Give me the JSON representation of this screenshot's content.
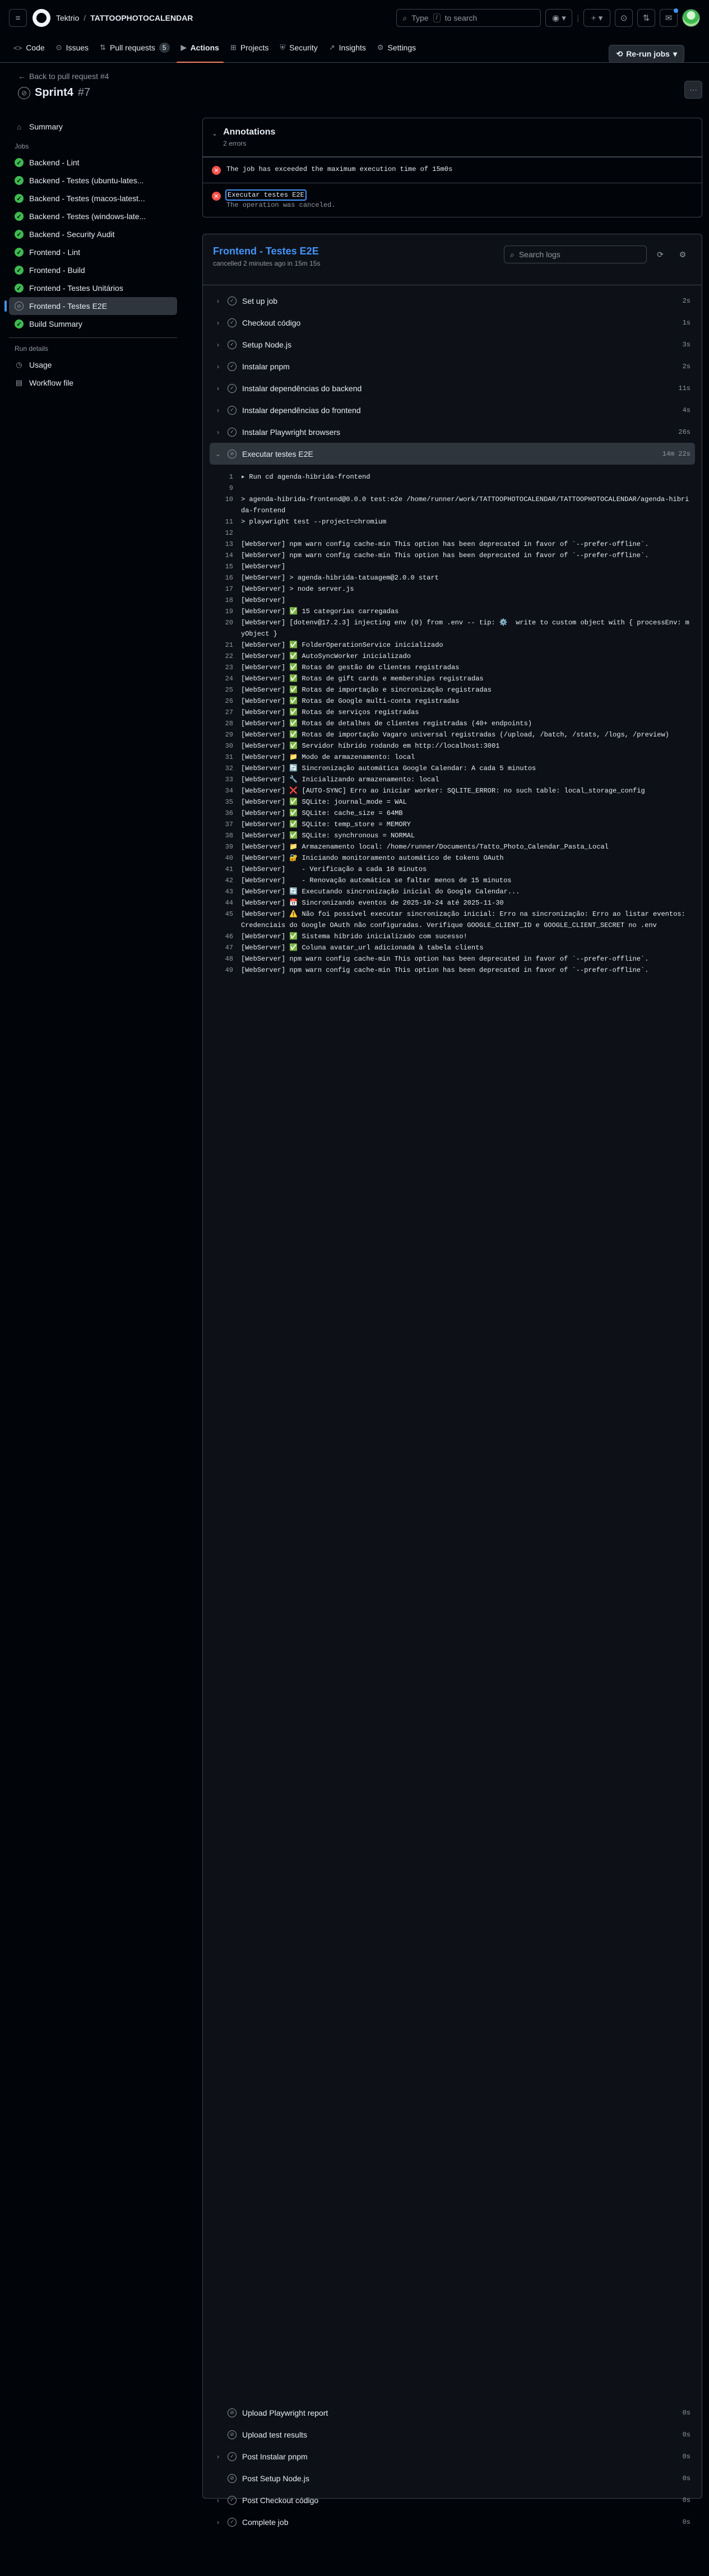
{
  "header": {
    "owner": "Tektrio",
    "separator": "/",
    "repo": "TATTOOPHOTOCALENDAR",
    "search_prefix": "Type",
    "search_key": "/",
    "search_suffix": "to search"
  },
  "nav": {
    "tabs": [
      {
        "icon": "<>",
        "label": "Code"
      },
      {
        "icon": "⊙",
        "label": "Issues"
      },
      {
        "icon": "⇅",
        "label": "Pull requests",
        "count": "5"
      },
      {
        "icon": "▶",
        "label": "Actions"
      },
      {
        "icon": "⊞",
        "label": "Projects"
      },
      {
        "icon": "⛨",
        "label": "Security"
      },
      {
        "icon": "↗",
        "label": "Insights"
      },
      {
        "icon": "⚙",
        "label": "Settings"
      }
    ]
  },
  "run": {
    "back_label": "Back to pull request #4",
    "title": "Sprint4",
    "number": "#7",
    "rerun_label": "Re-run jobs"
  },
  "sidebar": {
    "summary": "Summary",
    "jobs_label": "Jobs",
    "jobs": [
      "Backend - Lint",
      "Backend - Testes (ubuntu-lates...",
      "Backend - Testes (macos-latest...",
      "Backend - Testes (windows-late...",
      "Backend - Security Audit",
      "Frontend - Lint",
      "Frontend - Build",
      "Frontend - Testes Unitários",
      "Frontend - Testes E2E",
      "Build Summary"
    ],
    "run_details_label": "Run details",
    "usage": "Usage",
    "workflow_file": "Workflow file"
  },
  "annotations": {
    "title": "Annotations",
    "subtitle": "2 errors",
    "items": [
      {
        "title": "The job has exceeded the maximum execution time of 15m0s",
        "detail": ""
      },
      {
        "title": "Executar testes E2E",
        "detail": "The operation was canceled."
      }
    ]
  },
  "job": {
    "title": "Frontend - Testes E2E",
    "subtitle": "cancelled 2 minutes ago in 15m 15s",
    "search_placeholder": "Search logs",
    "steps": [
      {
        "label": "Set up job",
        "dur": "2s"
      },
      {
        "label": "Checkout código",
        "dur": "1s"
      },
      {
        "label": "Setup Node.js",
        "dur": "3s"
      },
      {
        "label": "Instalar pnpm",
        "dur": "2s"
      },
      {
        "label": "Instalar dependências do backend",
        "dur": "11s"
      },
      {
        "label": "Instalar dependências do frontend",
        "dur": "4s"
      },
      {
        "label": "Instalar Playwright browsers",
        "dur": "26s"
      }
    ],
    "open_step": {
      "label": "Executar testes E2E",
      "dur": "14m 22s"
    },
    "log": [
      {
        "n": "1",
        "t": "▸ Run cd agenda-hibrida-frontend"
      },
      {
        "n": "9",
        "t": ""
      },
      {
        "n": "10",
        "t": "> agenda-hibrida-frontend@0.0.0 test:e2e /home/runner/work/TATTOOPHOTOCALENDAR/TATTOOPHOTOCALENDAR/agenda-hibrida-frontend"
      },
      {
        "n": "11",
        "t": "> playwright test --project=chromium"
      },
      {
        "n": "12",
        "t": ""
      },
      {
        "n": "13",
        "t": "[WebServer] npm warn config cache-min This option has been deprecated in favor of `--prefer-offline`."
      },
      {
        "n": "14",
        "t": "[WebServer] npm warn config cache-min This option has been deprecated in favor of `--prefer-offline`."
      },
      {
        "n": "15",
        "t": "[WebServer]"
      },
      {
        "n": "16",
        "t": "[WebServer] > agenda-hibrida-tatuagem@2.0.0 start"
      },
      {
        "n": "17",
        "t": "[WebServer] > node server.js"
      },
      {
        "n": "18",
        "t": "[WebServer]"
      },
      {
        "n": "19",
        "t": "[WebServer] ✅ 15 categorias carregadas"
      },
      {
        "n": "20",
        "t": "[WebServer] [dotenv@17.2.3] injecting env (0) from .env -- tip: ⚙️  write to custom object with { processEnv: myObject }"
      },
      {
        "n": "21",
        "t": "[WebServer] ✅ FolderOperationService inicializado"
      },
      {
        "n": "22",
        "t": "[WebServer] ✅ AutoSyncWorker inicializado"
      },
      {
        "n": "23",
        "t": "[WebServer] ✅ Rotas de gestão de clientes registradas"
      },
      {
        "n": "24",
        "t": "[WebServer] ✅ Rotas de gift cards e memberships registradas"
      },
      {
        "n": "25",
        "t": "[WebServer] ✅ Rotas de importação e sincronização registradas"
      },
      {
        "n": "26",
        "t": "[WebServer] ✅ Rotas de Google multi-conta registradas"
      },
      {
        "n": "27",
        "t": "[WebServer] ✅ Rotas de serviços registradas"
      },
      {
        "n": "28",
        "t": "[WebServer] ✅ Rotas de detalhes de clientes registradas (40+ endpoints)"
      },
      {
        "n": "29",
        "t": "[WebServer] ✅ Rotas de importação Vagaro universal registradas (/upload, /batch, /stats, /logs, /preview)"
      },
      {
        "n": "30",
        "t": "[WebServer] ✅ Servidor híbrido rodando em http://localhost:3001"
      },
      {
        "n": "31",
        "t": "[WebServer] 📁 Modo de armazenamento: local"
      },
      {
        "n": "32",
        "t": "[WebServer] 🔄 Sincronização automática Google Calendar: A cada 5 minutos"
      },
      {
        "n": "33",
        "t": "[WebServer] 🔧 Inicializando armazenamento: local"
      },
      {
        "n": "34",
        "t": "[WebServer] ❌ [AUTO-SYNC] Erro ao iniciar worker: SQLITE_ERROR: no such table: local_storage_config"
      },
      {
        "n": "35",
        "t": "[WebServer] ✅ SQLite: journal_mode = WAL"
      },
      {
        "n": "36",
        "t": "[WebServer] ✅ SQLite: cache_size = 64MB"
      },
      {
        "n": "37",
        "t": "[WebServer] ✅ SQLite: temp_store = MEMORY"
      },
      {
        "n": "38",
        "t": "[WebServer] ✅ SQLite: synchronous = NORMAL"
      },
      {
        "n": "39",
        "t": "[WebServer] 📁 Armazenamento local: /home/runner/Documents/Tatto_Photo_Calendar_Pasta_Local"
      },
      {
        "n": "40",
        "t": "[WebServer] 🔐 Iniciando monitoramento automático de tokens OAuth"
      },
      {
        "n": "41",
        "t": "[WebServer]    - Verificação a cada 10 minutos"
      },
      {
        "n": "42",
        "t": "[WebServer]    - Renovação automática se faltar menos de 15 minutos"
      },
      {
        "n": "43",
        "t": "[WebServer] 🔄 Executando sincronização inicial do Google Calendar..."
      },
      {
        "n": "44",
        "t": "[WebServer] 📅 Sincronizando eventos de 2025-10-24 até 2025-11-30"
      },
      {
        "n": "45",
        "t": "[WebServer] ⚠️ Não foi possível executar sincronização inicial: Erro na sincronização: Erro ao listar eventos: Credenciais do Google OAuth não configuradas. Verifique GOOGLE_CLIENT_ID e GOOGLE_CLIENT_SECRET no .env"
      },
      {
        "n": "46",
        "t": "[WebServer] ✅ Sistema híbrido inicializado com sucesso!"
      },
      {
        "n": "47",
        "t": "[WebServer] ✅ Coluna avatar_url adicionada à tabela clients"
      },
      {
        "n": "48",
        "t": "[WebServer] npm warn config cache-min This option has been deprecated in favor of `--prefer-offline`."
      },
      {
        "n": "49",
        "t": "[WebServer] npm warn config cache-min This option has been deprecated in favor of `--prefer-offline`."
      }
    ],
    "bottom_steps": [
      {
        "label": "Upload Playwright report",
        "dur": "0s",
        "expand": false
      },
      {
        "label": "Upload test results",
        "dur": "0s",
        "expand": false
      },
      {
        "label": "Post Instalar pnpm",
        "dur": "0s",
        "expand": true
      },
      {
        "label": "Post Setup Node.js",
        "dur": "0s",
        "expand": false
      },
      {
        "label": "Post Checkout código",
        "dur": "0s",
        "expand": true
      },
      {
        "label": "Complete job",
        "dur": "0s",
        "expand": true
      }
    ]
  }
}
